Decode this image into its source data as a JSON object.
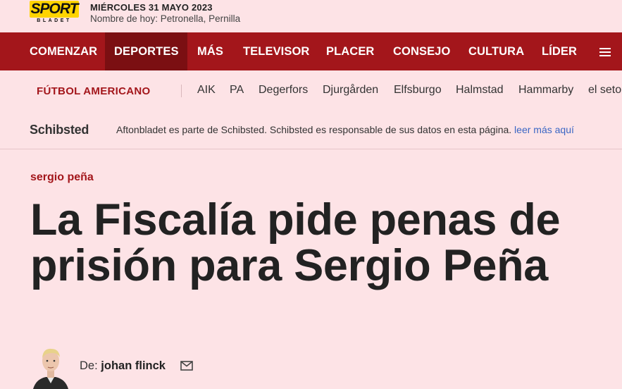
{
  "header": {
    "logo": {
      "word": "SPORT",
      "sub": "BLADET",
      "color": "#ffd400"
    },
    "date": "MIÉRCOLES 31 MAYO 2023",
    "names_of_day": "Nombre de hoy: Petronella, Pernilla"
  },
  "nav": {
    "items": [
      {
        "label": "COMENZAR",
        "active": false
      },
      {
        "label": "DEPORTES",
        "active": true
      },
      {
        "label": "MÁS",
        "active": false
      },
      {
        "label": "TELEVISOR",
        "active": false
      },
      {
        "label": "PLACER",
        "active": false
      },
      {
        "label": "CONSEJO",
        "active": false
      },
      {
        "label": "CULTURA",
        "active": false
      },
      {
        "label": "LÍDER",
        "active": false
      }
    ],
    "menu_icon": "hamburger-icon",
    "color": "#a3161b",
    "active_color": "#7b0f12"
  },
  "subnav": {
    "section": "FÚTBOL AMERICANO",
    "teams": [
      "AIK",
      "PA",
      "Degerfors",
      "Djurgården",
      "Elfsburgo",
      "Halmstad",
      "Hammarby",
      "el seto"
    ]
  },
  "schibsted": {
    "logo": "Schibsted",
    "text": "Aftonbladet es parte de Schibsted. Schibsted es responsable de sus datos en esta página.",
    "link": "leer más aquí"
  },
  "article": {
    "kicker": "sergio peña",
    "headline": "La Fiscalía pide penas de prisión para Sergio Peña",
    "byline_prefix": "De:",
    "author": "johan flinck",
    "mail_icon": "mail-icon"
  }
}
